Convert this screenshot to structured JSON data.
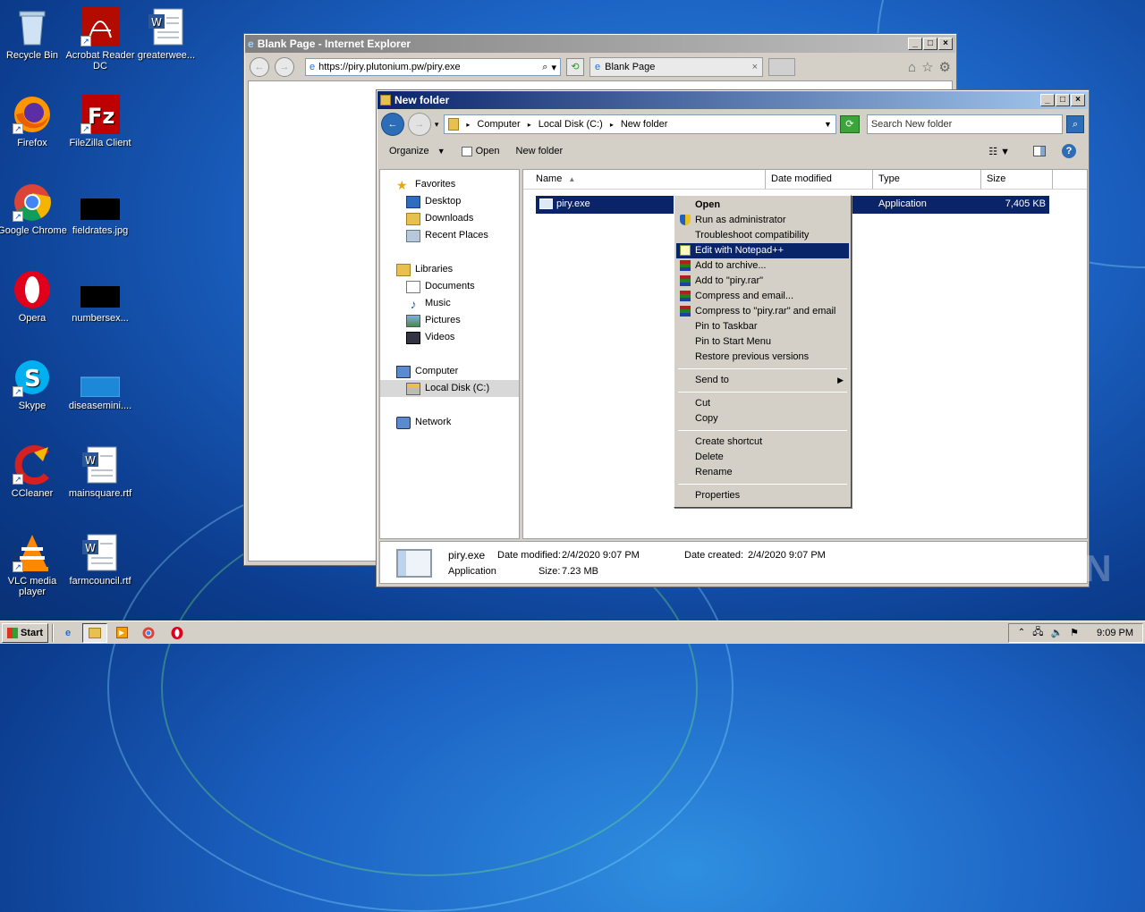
{
  "desktop": {
    "icons": [
      {
        "label": "Recycle Bin"
      },
      {
        "label": "Acrobat Reader DC"
      },
      {
        "label": "greaterwee..."
      },
      {
        "label": "Firefox"
      },
      {
        "label": "FileZilla Client"
      },
      {
        "label": "Google Chrome"
      },
      {
        "label": "fieldrates.jpg"
      },
      {
        "label": "Opera"
      },
      {
        "label": "numbersex..."
      },
      {
        "label": "Skype"
      },
      {
        "label": "diseasemini...."
      },
      {
        "label": "CCleaner"
      },
      {
        "label": "mainsquare.rtf"
      },
      {
        "label": "VLC media player"
      },
      {
        "label": "farmcouncil.rtf"
      }
    ]
  },
  "ie": {
    "title": "Blank Page - Internet Explorer",
    "url": "https://piry.plutonium.pw/piry.exe",
    "tab": "Blank Page"
  },
  "explorer": {
    "title": "New folder",
    "breadcrumb": [
      "Computer",
      "Local Disk (C:)",
      "New folder"
    ],
    "search_placeholder": "Search New folder",
    "toolbar": {
      "organize": "Organize",
      "open": "Open",
      "new_folder": "New folder"
    },
    "nav": {
      "favorites": "Favorites",
      "desktop": "Desktop",
      "downloads": "Downloads",
      "recent": "Recent Places",
      "libraries": "Libraries",
      "documents": "Documents",
      "music": "Music",
      "pictures": "Pictures",
      "videos": "Videos",
      "computer": "Computer",
      "local_disk": "Local Disk (C:)",
      "network": "Network"
    },
    "columns": {
      "name": "Name",
      "date": "Date modified",
      "type": "Type",
      "size": "Size"
    },
    "file": {
      "name": "piry.exe",
      "type": "Application",
      "size": "7,405 KB"
    },
    "details": {
      "name": "piry.exe",
      "modified_label": "Date modified:",
      "modified": "2/4/2020 9:07 PM",
      "created_label": "Date created:",
      "created": "2/4/2020 9:07 PM",
      "type": "Application",
      "size_label": "Size:",
      "size": "7.23 MB"
    }
  },
  "context_menu": {
    "open": "Open",
    "run_admin": "Run as administrator",
    "troubleshoot": "Troubleshoot compatibility",
    "notepad": "Edit with Notepad++",
    "add_archive": "Add to archive...",
    "add_rar": "Add to \"piry.rar\"",
    "compress_email": "Compress and email...",
    "compress_rar_email": "Compress to \"piry.rar\" and email",
    "pin_taskbar": "Pin to Taskbar",
    "pin_start": "Pin to Start Menu",
    "restore": "Restore previous versions",
    "send_to": "Send to",
    "cut": "Cut",
    "copy": "Copy",
    "shortcut": "Create shortcut",
    "delete": "Delete",
    "rename": "Rename",
    "properties": "Properties"
  },
  "taskbar": {
    "start": "Start",
    "clock": "9:09 PM"
  },
  "watermark": "ANY RUN"
}
